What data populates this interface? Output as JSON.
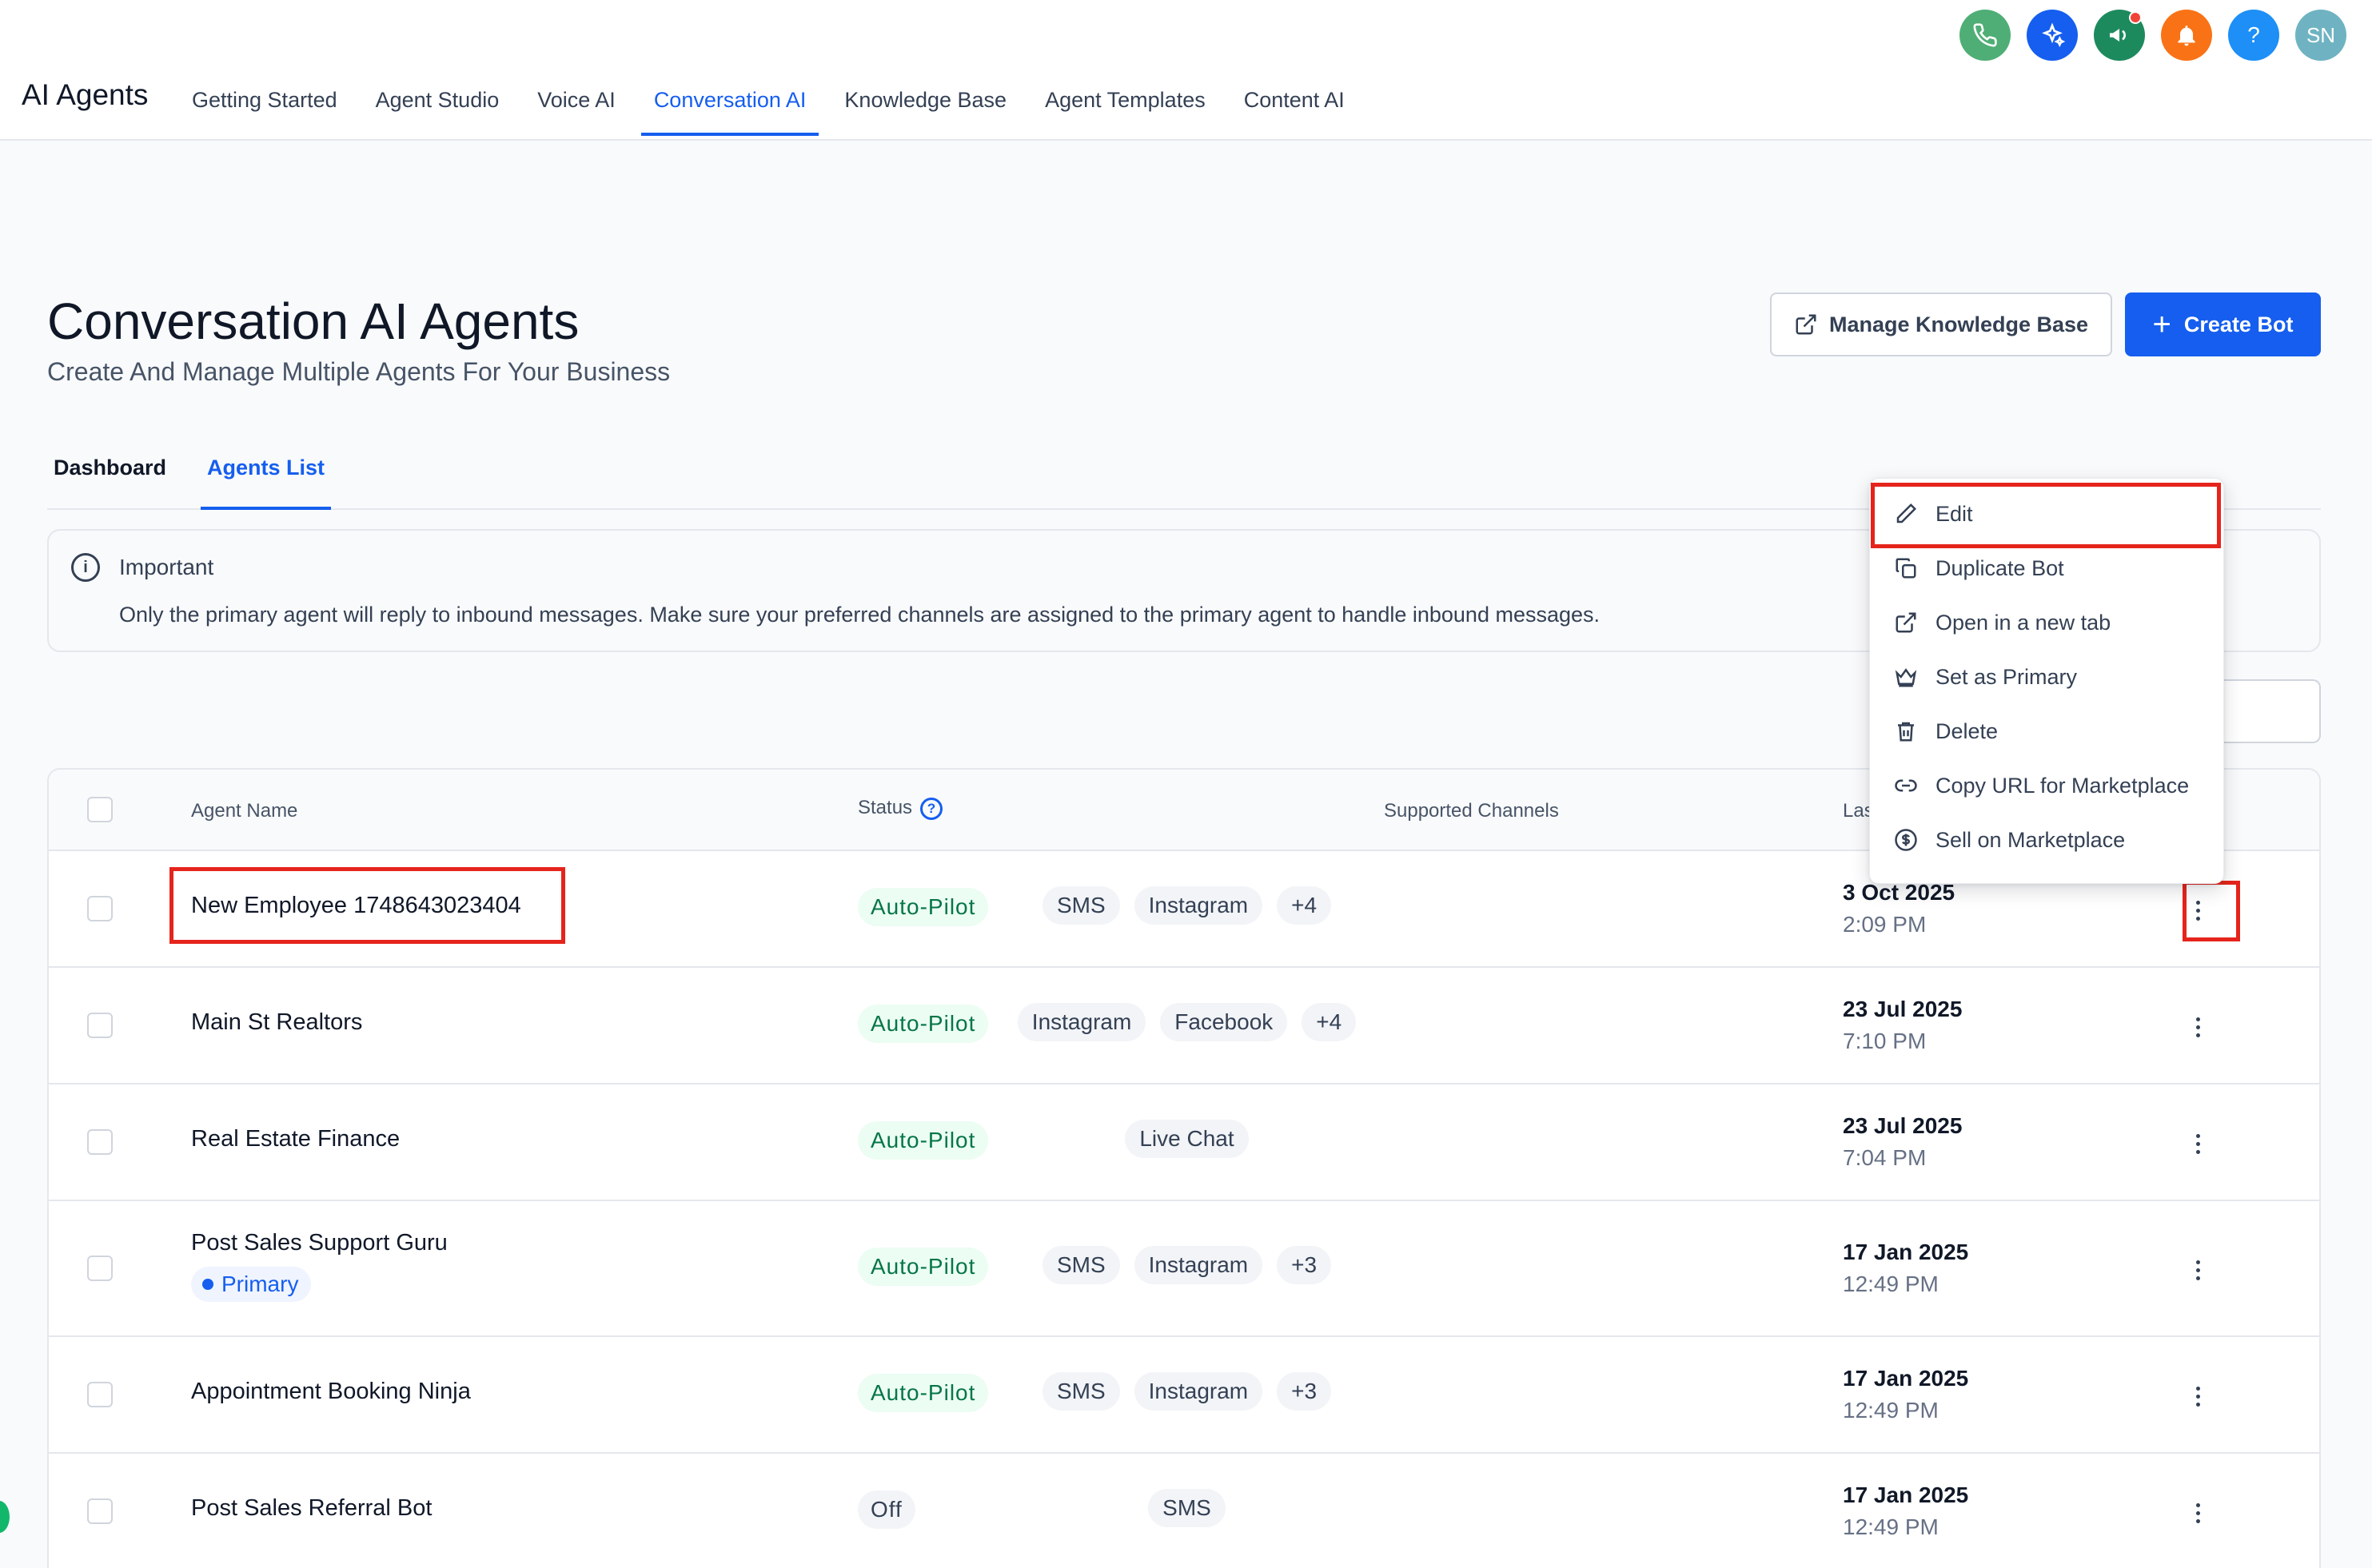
{
  "app": {
    "title": "AI Agents"
  },
  "nav": {
    "items": [
      "Getting Started",
      "Agent Studio",
      "Voice AI",
      "Conversation AI",
      "Knowledge Base",
      "Agent Templates",
      "Content AI"
    ],
    "active": "Conversation AI"
  },
  "top_icons": {
    "phone": "phone-icon",
    "sparkle": "sparkle-icon",
    "megaphone": "megaphone-icon",
    "bell": "bell-icon",
    "help": "?",
    "avatar": "SN"
  },
  "header": {
    "title": "Conversation AI Agents",
    "subtitle": "Create And Manage Multiple Agents For Your Business",
    "manage_label": "Manage Knowledge Base",
    "create_label": "Create Bot"
  },
  "tabs": {
    "dashboard": "Dashboard",
    "agents_list": "Agents List",
    "active": "Agents List"
  },
  "notice": {
    "title": "Important",
    "text": "Only the primary agent will reply to inbound messages. Make sure your preferred channels are assigned to the primary agent to handle inbound messages."
  },
  "table": {
    "columns": {
      "name": "Agent Name",
      "status": "Status",
      "channels": "Supported Channels",
      "last": "Las"
    },
    "rows": [
      {
        "name": "New Employee 1748643023404",
        "status": "Auto-Pilot",
        "channels": [
          "SMS",
          "Instagram",
          "+4"
        ],
        "date": "3 Oct 2025",
        "time": "2:09 PM"
      },
      {
        "name": "Main St Realtors",
        "status": "Auto-Pilot",
        "channels": [
          "Instagram",
          "Facebook",
          "+4"
        ],
        "date": "23 Jul 2025",
        "time": "7:10 PM"
      },
      {
        "name": "Real Estate Finance",
        "status": "Auto-Pilot",
        "channels": [
          "Live Chat"
        ],
        "date": "23 Jul 2025",
        "time": "7:04 PM"
      },
      {
        "name": "Post Sales Support Guru",
        "badge": "Primary",
        "status": "Auto-Pilot",
        "channels": [
          "SMS",
          "Instagram",
          "+3"
        ],
        "date": "17 Jan 2025",
        "time": "12:49 PM"
      },
      {
        "name": "Appointment Booking Ninja",
        "status": "Auto-Pilot",
        "channels": [
          "SMS",
          "Instagram",
          "+3"
        ],
        "date": "17 Jan 2025",
        "time": "12:49 PM"
      },
      {
        "name": "Post Sales Referral Bot",
        "status": "Off",
        "channels": [
          "SMS"
        ],
        "date": "17 Jan 2025",
        "time": "12:49 PM"
      }
    ]
  },
  "menu": {
    "items": [
      {
        "label": "Edit",
        "icon": "pencil-icon"
      },
      {
        "label": "Duplicate Bot",
        "icon": "copy-icon"
      },
      {
        "label": "Open in a new tab",
        "icon": "external-link-icon"
      },
      {
        "label": "Set as Primary",
        "icon": "crown-icon"
      },
      {
        "label": "Delete",
        "icon": "trash-icon"
      },
      {
        "label": "Copy URL for Marketplace",
        "icon": "link-icon"
      },
      {
        "label": "Sell on Marketplace",
        "icon": "dollar-icon"
      }
    ]
  },
  "colors": {
    "accent": "#155eef",
    "highlight": "#e5241c",
    "status_on": "#067647"
  }
}
